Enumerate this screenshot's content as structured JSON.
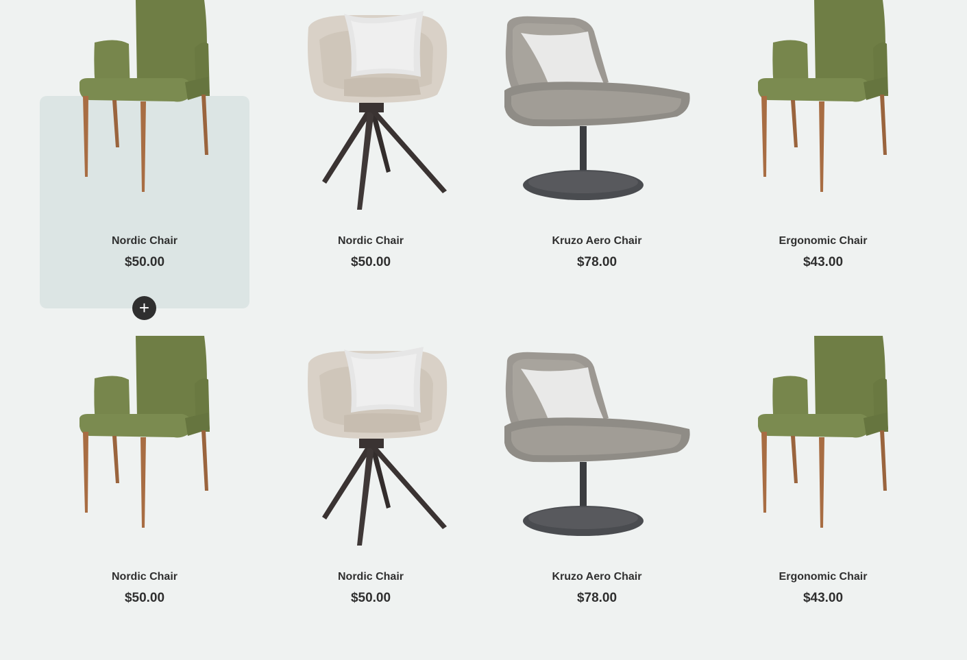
{
  "products": [
    {
      "title": "Nordic Chair",
      "price": "$50.00",
      "image": "green-armchair-image",
      "hovered": true,
      "add_icon": "+"
    },
    {
      "title": "Nordic Chair",
      "price": "$50.00",
      "image": "beige-swivel-chair-image"
    },
    {
      "title": "Kruzo Aero Chair",
      "price": "$78.00",
      "image": "grey-lounge-chair-image"
    },
    {
      "title": "Ergonomic Chair",
      "price": "$43.00",
      "image": "green-armchair-image"
    },
    {
      "title": "Nordic Chair",
      "price": "$50.00",
      "image": "green-armchair-image"
    },
    {
      "title": "Nordic Chair",
      "price": "$50.00",
      "image": "beige-swivel-chair-image"
    },
    {
      "title": "Kruzo Aero Chair",
      "price": "$78.00",
      "image": "grey-lounge-chair-image"
    },
    {
      "title": "Ergonomic Chair",
      "price": "$43.00",
      "image": "green-armchair-image"
    }
  ],
  "colors": {
    "background": "#eff2f1",
    "card_hover": "#dce5e4",
    "text": "#2f2f2f",
    "button": "#2f2f2f"
  }
}
